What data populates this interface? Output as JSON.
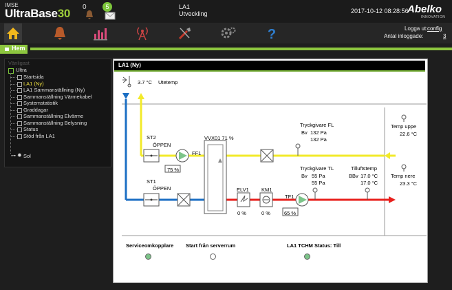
{
  "header": {
    "brand_small": "IMSE",
    "brand_name": "UltraBase",
    "brand_number": "30",
    "alarm_count": "0",
    "notification_count": "5",
    "site_name": "LA1",
    "site_sub": "Utveckling",
    "datetime": "2017-10-12 08:28:56",
    "logo": "Abelko",
    "logo_sub": "INNOVATION"
  },
  "nav": {
    "icons": [
      "home-icon",
      "bell-icon",
      "bar-chart-icon",
      "antenna-icon",
      "tools-icon",
      "gears-icon",
      "help-icon"
    ],
    "logout_label": "Logga ut:",
    "logout_user": "config",
    "logins_label": "Antal inloggade:",
    "logins_count": "3"
  },
  "page": {
    "title": "Hem"
  },
  "tree": {
    "root_faded": "Vänligast",
    "root": "Ultra",
    "items": [
      {
        "label": "Startsida",
        "active": false
      },
      {
        "label": "LA1 (Ny)",
        "active": true
      },
      {
        "label": "LA1 Sammanställning (Ny)",
        "active": false
      },
      {
        "label": "Sammanställning Värmekabel",
        "active": false
      },
      {
        "label": "Systemstatistik",
        "active": false
      },
      {
        "label": "Graddagar",
        "active": false
      },
      {
        "label": "Sammanställning Elvärme",
        "active": false
      },
      {
        "label": "Sammanställning Belysning",
        "active": false
      },
      {
        "label": "Status",
        "active": false
      },
      {
        "label": "Stöd från LA1",
        "active": false
      }
    ],
    "sol": "Sol"
  },
  "panel": {
    "title": "LA1 (Ny)",
    "outdoor_temp": "3.7 °C",
    "outdoor_label": "Utetemp",
    "st2_label": "ST2",
    "st2_state": "ÖPPEN",
    "st1_label": "ST1",
    "st1_state": "ÖPPEN",
    "ff1_label": "FF1",
    "ff1_speed": "75 %",
    "vvx_label": "VVX01 71 %",
    "elv_label": "ELV1",
    "elv_value": "0 %",
    "km_label": "KM1",
    "km_value": "0 %",
    "tf1_label": "TF1",
    "tf1_speed": "65 %",
    "fl_title": "Tryckgivare FL",
    "fl_bv_label": "Bv",
    "fl_bv": "132 Pa",
    "fl_value": "132 Pa",
    "tl_title": "Tryckgivare TL",
    "tl_bv_label": "Bv",
    "tl_bv": "55 Pa",
    "tl_value": "55 Pa",
    "supply_title": "Tilluftstemp",
    "supply_bbv_label": "BBv",
    "supply_bbv": "17.0 °C",
    "supply_value": "17.0 °C",
    "temp_upper_label": "Temp uppe",
    "temp_upper": "22.6 °C",
    "temp_lower_label": "Temp nere",
    "temp_lower": "23.3 °C",
    "service_label": "Serviceomkopplare",
    "server_start_label": "Start från serverrum",
    "status_label": "LA1 TCHM Status: Till"
  },
  "colors": {
    "accent_green": "#8dc63f",
    "supply_red": "#e8201c",
    "exhaust_yellow": "#f2ea2a",
    "outdoor_blue": "#1c6fc4",
    "led_green": "#7cc489"
  }
}
